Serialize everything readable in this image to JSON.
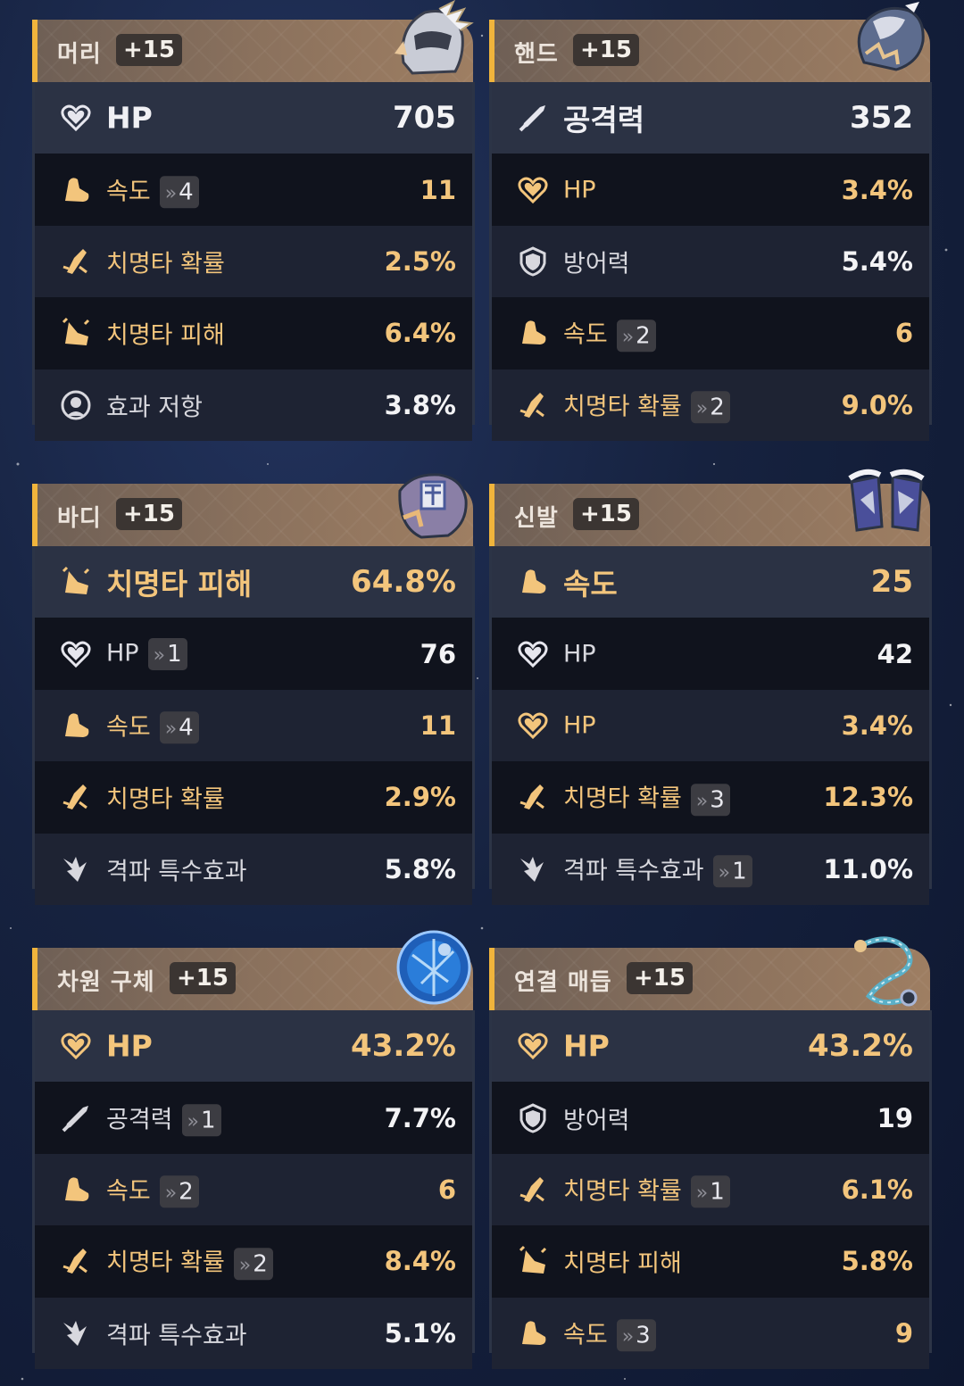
{
  "colors": {
    "accent_gold": "#f0b43c",
    "text_gold": "#f3c57c",
    "main_row_bg": "#2b3244",
    "dark_row_bg": "#10131d",
    "light_row_bg": "#1e2333",
    "badge_bg": "#3b3532"
  },
  "panels": [
    {
      "name": "머리",
      "level": "+15",
      "art": "helmet-art",
      "rows": [
        {
          "icon": "heart-icon",
          "label": "HP",
          "roll": "",
          "value": "705",
          "gold": false
        },
        {
          "icon": "speed-boot-icon",
          "label": "속도",
          "roll": "4",
          "value": "11",
          "gold": true
        },
        {
          "icon": "crit-chance-icon",
          "label": "치명타 확률",
          "roll": "",
          "value": "2.5%",
          "gold": true
        },
        {
          "icon": "crit-damage-icon",
          "label": "치명타 피해",
          "roll": "",
          "value": "6.4%",
          "gold": true
        },
        {
          "icon": "effect-resist-icon",
          "label": "효과 저항",
          "roll": "",
          "value": "3.8%",
          "gold": false
        }
      ]
    },
    {
      "name": "핸드",
      "level": "+15",
      "art": "gauntlet-art",
      "rows": [
        {
          "icon": "sword-icon",
          "label": "공격력",
          "roll": "",
          "value": "352",
          "gold": false
        },
        {
          "icon": "heart-gold-icon",
          "label": "HP",
          "roll": "",
          "value": "3.4%",
          "gold": true
        },
        {
          "icon": "shield-icon",
          "label": "방어력",
          "roll": "",
          "value": "5.4%",
          "gold": false
        },
        {
          "icon": "speed-boot-icon",
          "label": "속도",
          "roll": "2",
          "value": "6",
          "gold": true
        },
        {
          "icon": "crit-chance-icon",
          "label": "치명타 확률",
          "roll": "2",
          "value": "9.0%",
          "gold": true
        }
      ]
    },
    {
      "name": "바디",
      "level": "+15",
      "art": "armor-art",
      "rows": [
        {
          "icon": "crit-damage-icon",
          "label": "치명타 피해",
          "roll": "",
          "value": "64.8%",
          "gold": true
        },
        {
          "icon": "heart-icon",
          "label": "HP",
          "roll": "1",
          "value": "76",
          "gold": false
        },
        {
          "icon": "speed-boot-icon",
          "label": "속도",
          "roll": "4",
          "value": "11",
          "gold": true
        },
        {
          "icon": "crit-chance-icon",
          "label": "치명타 확률",
          "roll": "",
          "value": "2.9%",
          "gold": true
        },
        {
          "icon": "break-effect-icon",
          "label": "격파 특수효과",
          "roll": "",
          "value": "5.8%",
          "gold": false
        }
      ]
    },
    {
      "name": "신발",
      "level": "+15",
      "art": "boots-art",
      "rows": [
        {
          "icon": "speed-boot-icon",
          "label": "속도",
          "roll": "",
          "value": "25",
          "gold": true
        },
        {
          "icon": "heart-icon",
          "label": "HP",
          "roll": "",
          "value": "42",
          "gold": false
        },
        {
          "icon": "heart-gold-icon",
          "label": "HP",
          "roll": "",
          "value": "3.4%",
          "gold": true
        },
        {
          "icon": "crit-chance-icon",
          "label": "치명타 확률",
          "roll": "3",
          "value": "12.3%",
          "gold": true
        },
        {
          "icon": "break-effect-icon",
          "label": "격파 특수효과",
          "roll": "1",
          "value": "11.0%",
          "gold": false
        }
      ]
    },
    {
      "name": "차원 구체",
      "level": "+15",
      "art": "orb-art",
      "rows": [
        {
          "icon": "heart-gold-icon",
          "label": "HP",
          "roll": "",
          "value": "43.2%",
          "gold": true
        },
        {
          "icon": "sword-icon",
          "label": "공격력",
          "roll": "1",
          "value": "7.7%",
          "gold": false
        },
        {
          "icon": "speed-boot-icon",
          "label": "속도",
          "roll": "2",
          "value": "6",
          "gold": true
        },
        {
          "icon": "crit-chance-icon",
          "label": "치명타 확률",
          "roll": "2",
          "value": "8.4%",
          "gold": true
        },
        {
          "icon": "break-effect-icon",
          "label": "격파 특수효과",
          "roll": "",
          "value": "5.1%",
          "gold": false
        }
      ]
    },
    {
      "name": "연결 매듭",
      "level": "+15",
      "art": "rope-art",
      "rows": [
        {
          "icon": "heart-gold-icon",
          "label": "HP",
          "roll": "",
          "value": "43.2%",
          "gold": true
        },
        {
          "icon": "shield-icon",
          "label": "방어력",
          "roll": "",
          "value": "19",
          "gold": false
        },
        {
          "icon": "crit-chance-icon",
          "label": "치명타 확률",
          "roll": "1",
          "value": "6.1%",
          "gold": true
        },
        {
          "icon": "crit-damage-icon",
          "label": "치명타 피해",
          "roll": "",
          "value": "5.8%",
          "gold": true
        },
        {
          "icon": "speed-boot-icon",
          "label": "속도",
          "roll": "3",
          "value": "9",
          "gold": true
        }
      ]
    }
  ]
}
